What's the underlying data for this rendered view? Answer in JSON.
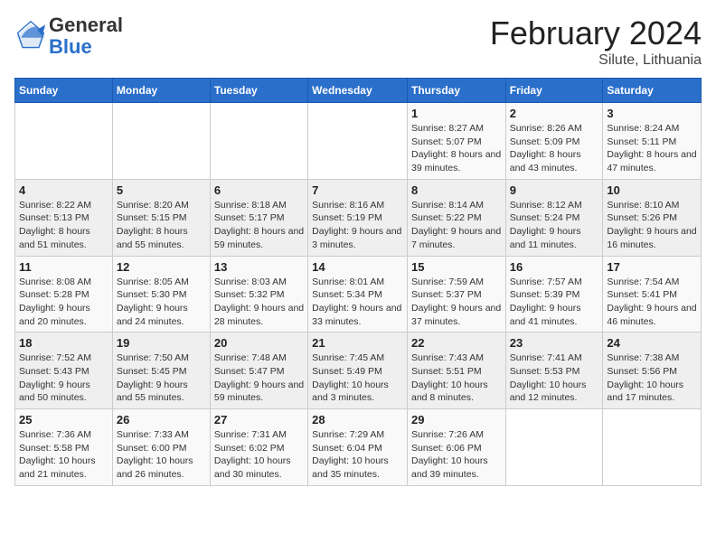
{
  "header": {
    "logo_line1": "General",
    "logo_line2": "Blue",
    "month_title": "February 2024",
    "location": "Silute, Lithuania"
  },
  "days_of_week": [
    "Sunday",
    "Monday",
    "Tuesday",
    "Wednesday",
    "Thursday",
    "Friday",
    "Saturday"
  ],
  "weeks": [
    [
      {
        "day": "",
        "info": ""
      },
      {
        "day": "",
        "info": ""
      },
      {
        "day": "",
        "info": ""
      },
      {
        "day": "",
        "info": ""
      },
      {
        "day": "1",
        "info": "Sunrise: 8:27 AM\nSunset: 5:07 PM\nDaylight: 8 hours and 39 minutes."
      },
      {
        "day": "2",
        "info": "Sunrise: 8:26 AM\nSunset: 5:09 PM\nDaylight: 8 hours and 43 minutes."
      },
      {
        "day": "3",
        "info": "Sunrise: 8:24 AM\nSunset: 5:11 PM\nDaylight: 8 hours and 47 minutes."
      }
    ],
    [
      {
        "day": "4",
        "info": "Sunrise: 8:22 AM\nSunset: 5:13 PM\nDaylight: 8 hours and 51 minutes."
      },
      {
        "day": "5",
        "info": "Sunrise: 8:20 AM\nSunset: 5:15 PM\nDaylight: 8 hours and 55 minutes."
      },
      {
        "day": "6",
        "info": "Sunrise: 8:18 AM\nSunset: 5:17 PM\nDaylight: 8 hours and 59 minutes."
      },
      {
        "day": "7",
        "info": "Sunrise: 8:16 AM\nSunset: 5:19 PM\nDaylight: 9 hours and 3 minutes."
      },
      {
        "day": "8",
        "info": "Sunrise: 8:14 AM\nSunset: 5:22 PM\nDaylight: 9 hours and 7 minutes."
      },
      {
        "day": "9",
        "info": "Sunrise: 8:12 AM\nSunset: 5:24 PM\nDaylight: 9 hours and 11 minutes."
      },
      {
        "day": "10",
        "info": "Sunrise: 8:10 AM\nSunset: 5:26 PM\nDaylight: 9 hours and 16 minutes."
      }
    ],
    [
      {
        "day": "11",
        "info": "Sunrise: 8:08 AM\nSunset: 5:28 PM\nDaylight: 9 hours and 20 minutes."
      },
      {
        "day": "12",
        "info": "Sunrise: 8:05 AM\nSunset: 5:30 PM\nDaylight: 9 hours and 24 minutes."
      },
      {
        "day": "13",
        "info": "Sunrise: 8:03 AM\nSunset: 5:32 PM\nDaylight: 9 hours and 28 minutes."
      },
      {
        "day": "14",
        "info": "Sunrise: 8:01 AM\nSunset: 5:34 PM\nDaylight: 9 hours and 33 minutes."
      },
      {
        "day": "15",
        "info": "Sunrise: 7:59 AM\nSunset: 5:37 PM\nDaylight: 9 hours and 37 minutes."
      },
      {
        "day": "16",
        "info": "Sunrise: 7:57 AM\nSunset: 5:39 PM\nDaylight: 9 hours and 41 minutes."
      },
      {
        "day": "17",
        "info": "Sunrise: 7:54 AM\nSunset: 5:41 PM\nDaylight: 9 hours and 46 minutes."
      }
    ],
    [
      {
        "day": "18",
        "info": "Sunrise: 7:52 AM\nSunset: 5:43 PM\nDaylight: 9 hours and 50 minutes."
      },
      {
        "day": "19",
        "info": "Sunrise: 7:50 AM\nSunset: 5:45 PM\nDaylight: 9 hours and 55 minutes."
      },
      {
        "day": "20",
        "info": "Sunrise: 7:48 AM\nSunset: 5:47 PM\nDaylight: 9 hours and 59 minutes."
      },
      {
        "day": "21",
        "info": "Sunrise: 7:45 AM\nSunset: 5:49 PM\nDaylight: 10 hours and 3 minutes."
      },
      {
        "day": "22",
        "info": "Sunrise: 7:43 AM\nSunset: 5:51 PM\nDaylight: 10 hours and 8 minutes."
      },
      {
        "day": "23",
        "info": "Sunrise: 7:41 AM\nSunset: 5:53 PM\nDaylight: 10 hours and 12 minutes."
      },
      {
        "day": "24",
        "info": "Sunrise: 7:38 AM\nSunset: 5:56 PM\nDaylight: 10 hours and 17 minutes."
      }
    ],
    [
      {
        "day": "25",
        "info": "Sunrise: 7:36 AM\nSunset: 5:58 PM\nDaylight: 10 hours and 21 minutes."
      },
      {
        "day": "26",
        "info": "Sunrise: 7:33 AM\nSunset: 6:00 PM\nDaylight: 10 hours and 26 minutes."
      },
      {
        "day": "27",
        "info": "Sunrise: 7:31 AM\nSunset: 6:02 PM\nDaylight: 10 hours and 30 minutes."
      },
      {
        "day": "28",
        "info": "Sunrise: 7:29 AM\nSunset: 6:04 PM\nDaylight: 10 hours and 35 minutes."
      },
      {
        "day": "29",
        "info": "Sunrise: 7:26 AM\nSunset: 6:06 PM\nDaylight: 10 hours and 39 minutes."
      },
      {
        "day": "",
        "info": ""
      },
      {
        "day": "",
        "info": ""
      }
    ]
  ]
}
